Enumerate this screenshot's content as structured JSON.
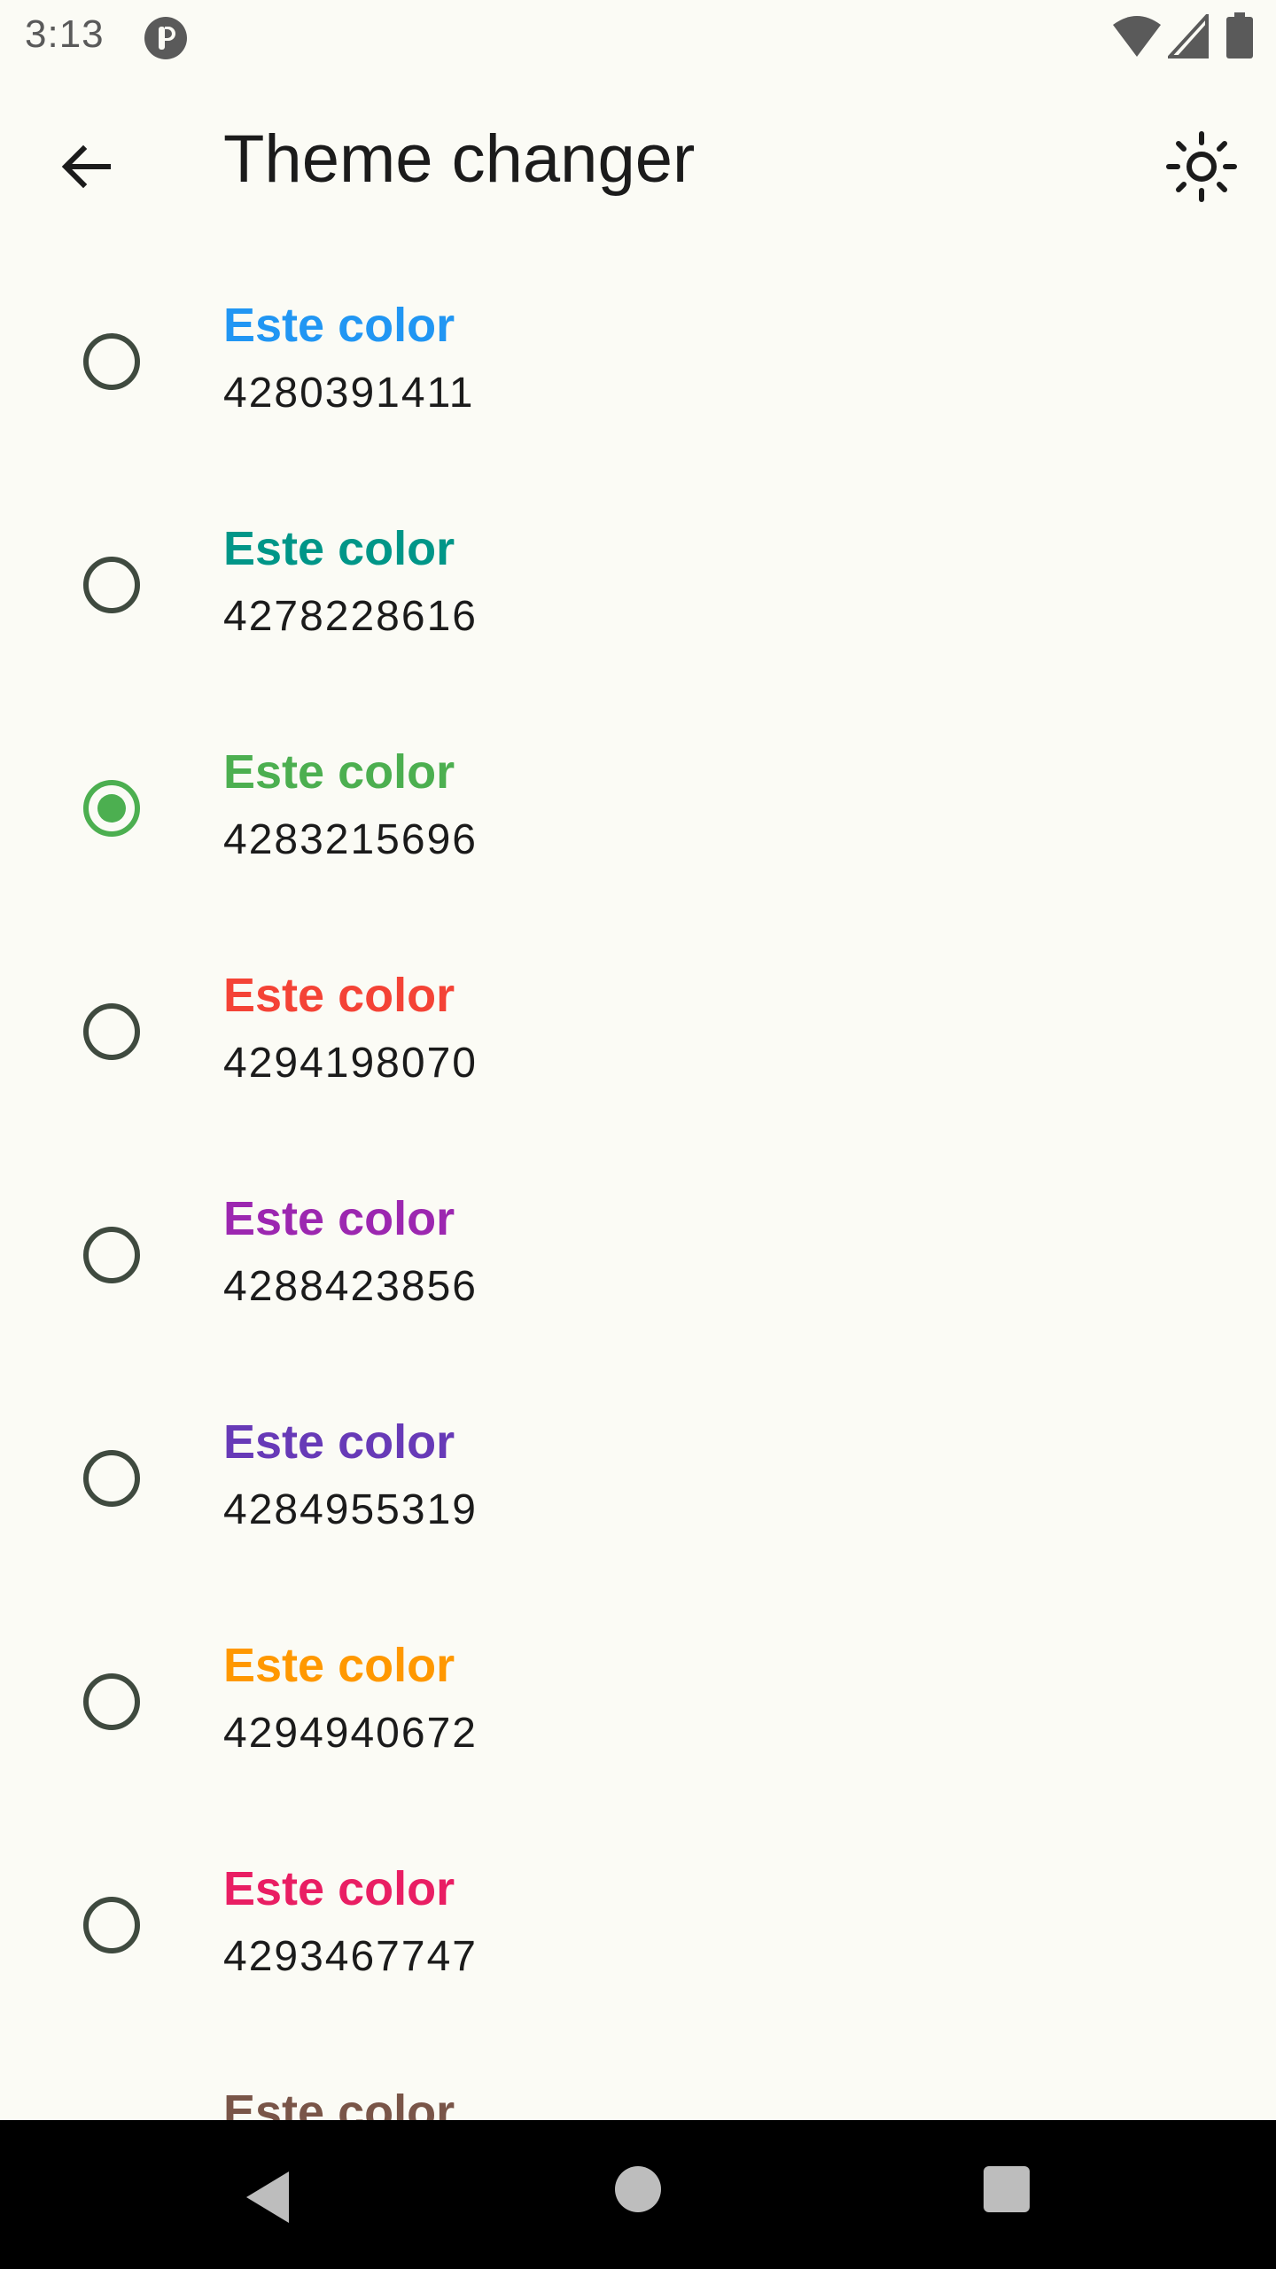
{
  "status_bar": {
    "time": "3:13",
    "icons": [
      "app-notification-icon",
      "wifi-icon",
      "cell-signal-icon",
      "battery-icon"
    ]
  },
  "app_bar": {
    "back_icon": "arrow-back-icon",
    "title": "Theme changer",
    "theme_icon": "brightness-sun-icon"
  },
  "colors": [
    {
      "label": "Este color",
      "value": "4280391411",
      "color": "#2196F3",
      "selected": false
    },
    {
      "label": "Este color",
      "value": "4278228616",
      "color": "#009688",
      "selected": false
    },
    {
      "label": "Este color",
      "value": "4283215696",
      "color": "#4CAF50",
      "selected": true
    },
    {
      "label": "Este color",
      "value": "4294198070",
      "color": "#F44336",
      "selected": false
    },
    {
      "label": "Este color",
      "value": "4288423856",
      "color": "#9C27B0",
      "selected": false
    },
    {
      "label": "Este color",
      "value": "4284955319",
      "color": "#673AB7",
      "selected": false
    },
    {
      "label": "Este color",
      "value": "4294940672",
      "color": "#FF9800",
      "selected": false
    },
    {
      "label": "Este color",
      "value": "4293467747",
      "color": "#E91E63",
      "selected": false
    },
    {
      "label": "Este color",
      "value": "",
      "color": "#795548",
      "selected": false
    }
  ],
  "nav_bar": {
    "icons": [
      "nav-back-icon",
      "nav-home-icon",
      "nav-recents-icon"
    ]
  }
}
